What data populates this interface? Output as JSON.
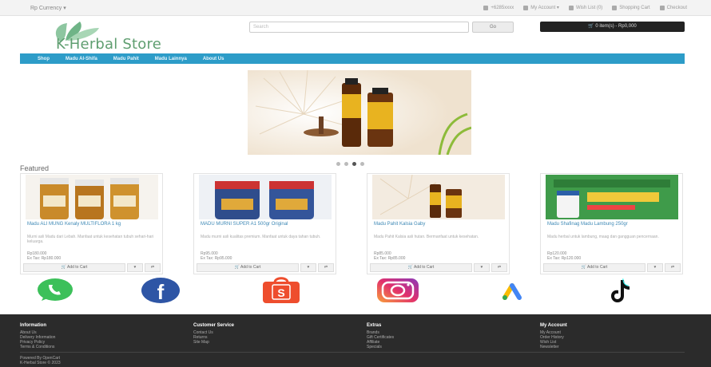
{
  "topbar": {
    "currency": "Rp Currency ▾",
    "links": [
      {
        "icon": "phone-icon",
        "label": "+6285xxxx"
      },
      {
        "icon": "user-icon",
        "label": "My Account ▾"
      },
      {
        "icon": "heart-icon",
        "label": "Wish List (0)"
      },
      {
        "icon": "cart-icon",
        "label": "Shopping Cart"
      },
      {
        "icon": "share-icon",
        "label": "Checkout"
      }
    ]
  },
  "header": {
    "logo_text": "K-Herbal Store",
    "search_placeholder": "Search",
    "search_button": "Go",
    "cart_button": "🛒 0 item(s) - Rp0,000"
  },
  "nav": {
    "items": [
      "Shop",
      "Madu Al-Shifa",
      "Madu Pahit",
      "Madu Lainnya",
      "About Us"
    ]
  },
  "slider": {
    "dots": 4,
    "active": 3
  },
  "featured": {
    "title": "Featured"
  },
  "products": [
    {
      "title": "Madu ALI MUNG Kenaly MULTIFLORA 1 kg",
      "desc": "Murni asli Madu dari Lebah. Manfaat untuk kesehatan tubuh sehari-hari keluarga.",
      "price": "Rp180.000",
      "price_note": "Ex Tax: Rp180.000",
      "add_to_cart": "🛒 Add to Cart"
    },
    {
      "title": "MADU MURNI SUPER A1 500gr Original",
      "desc": "Madu murni asli kualitas premium. Manfaat untuk daya tahan tubuh.",
      "price": "Rp95.000",
      "price_note": "Ex Tax: Rp95.000",
      "add_to_cart": "🛒 Add to Cart"
    },
    {
      "title": "Madu Pahit Kalsia Gaby",
      "desc": "Madu Pahit Kalsia asli hutan. Bermanfaat untuk kesehatan.",
      "price": "Rp85.000",
      "price_note": "Ex Tax: Rp85.000",
      "add_to_cart": "🛒 Add to Cart"
    },
    {
      "title": "Madu Shafinag Madu Lambung 250gr",
      "desc": "Madu herbal untuk lambung, maag dan gangguan pencernaan.",
      "price": "Rp120.000",
      "price_note": "Ex Tax: Rp120.000",
      "add_to_cart": "🛒 Add to Cart"
    }
  ],
  "social": [
    {
      "icon": "whatsapp-icon",
      "color": "#3cc05a"
    },
    {
      "icon": "facebook-icon",
      "color": "#2e55a5"
    },
    {
      "icon": "shopee-icon",
      "color": "#ee4d2d"
    },
    {
      "icon": "instagram-icon",
      "color": "#c2359e"
    },
    {
      "icon": "google-ads-icon",
      "color": "#4285f4"
    },
    {
      "icon": "tiktok-icon",
      "color": "#111111"
    }
  ],
  "footer": {
    "columns": [
      {
        "title": "Information",
        "links": [
          "About Us",
          "Delivery Information",
          "Privacy Policy",
          "Terms & Conditions"
        ]
      },
      {
        "title": "Customer Service",
        "links": [
          "Contact Us",
          "Returns",
          "Site Map"
        ]
      },
      {
        "title": "Extras",
        "links": [
          "Brands",
          "Gift Certificates",
          "Affiliate",
          "Specials"
        ]
      },
      {
        "title": "My Account",
        "links": [
          "My Account",
          "Order History",
          "Wish List",
          "Newsletter"
        ]
      }
    ],
    "powered": "Powered By OpenCart",
    "copyright": "K-Herbal Store © 2023"
  }
}
